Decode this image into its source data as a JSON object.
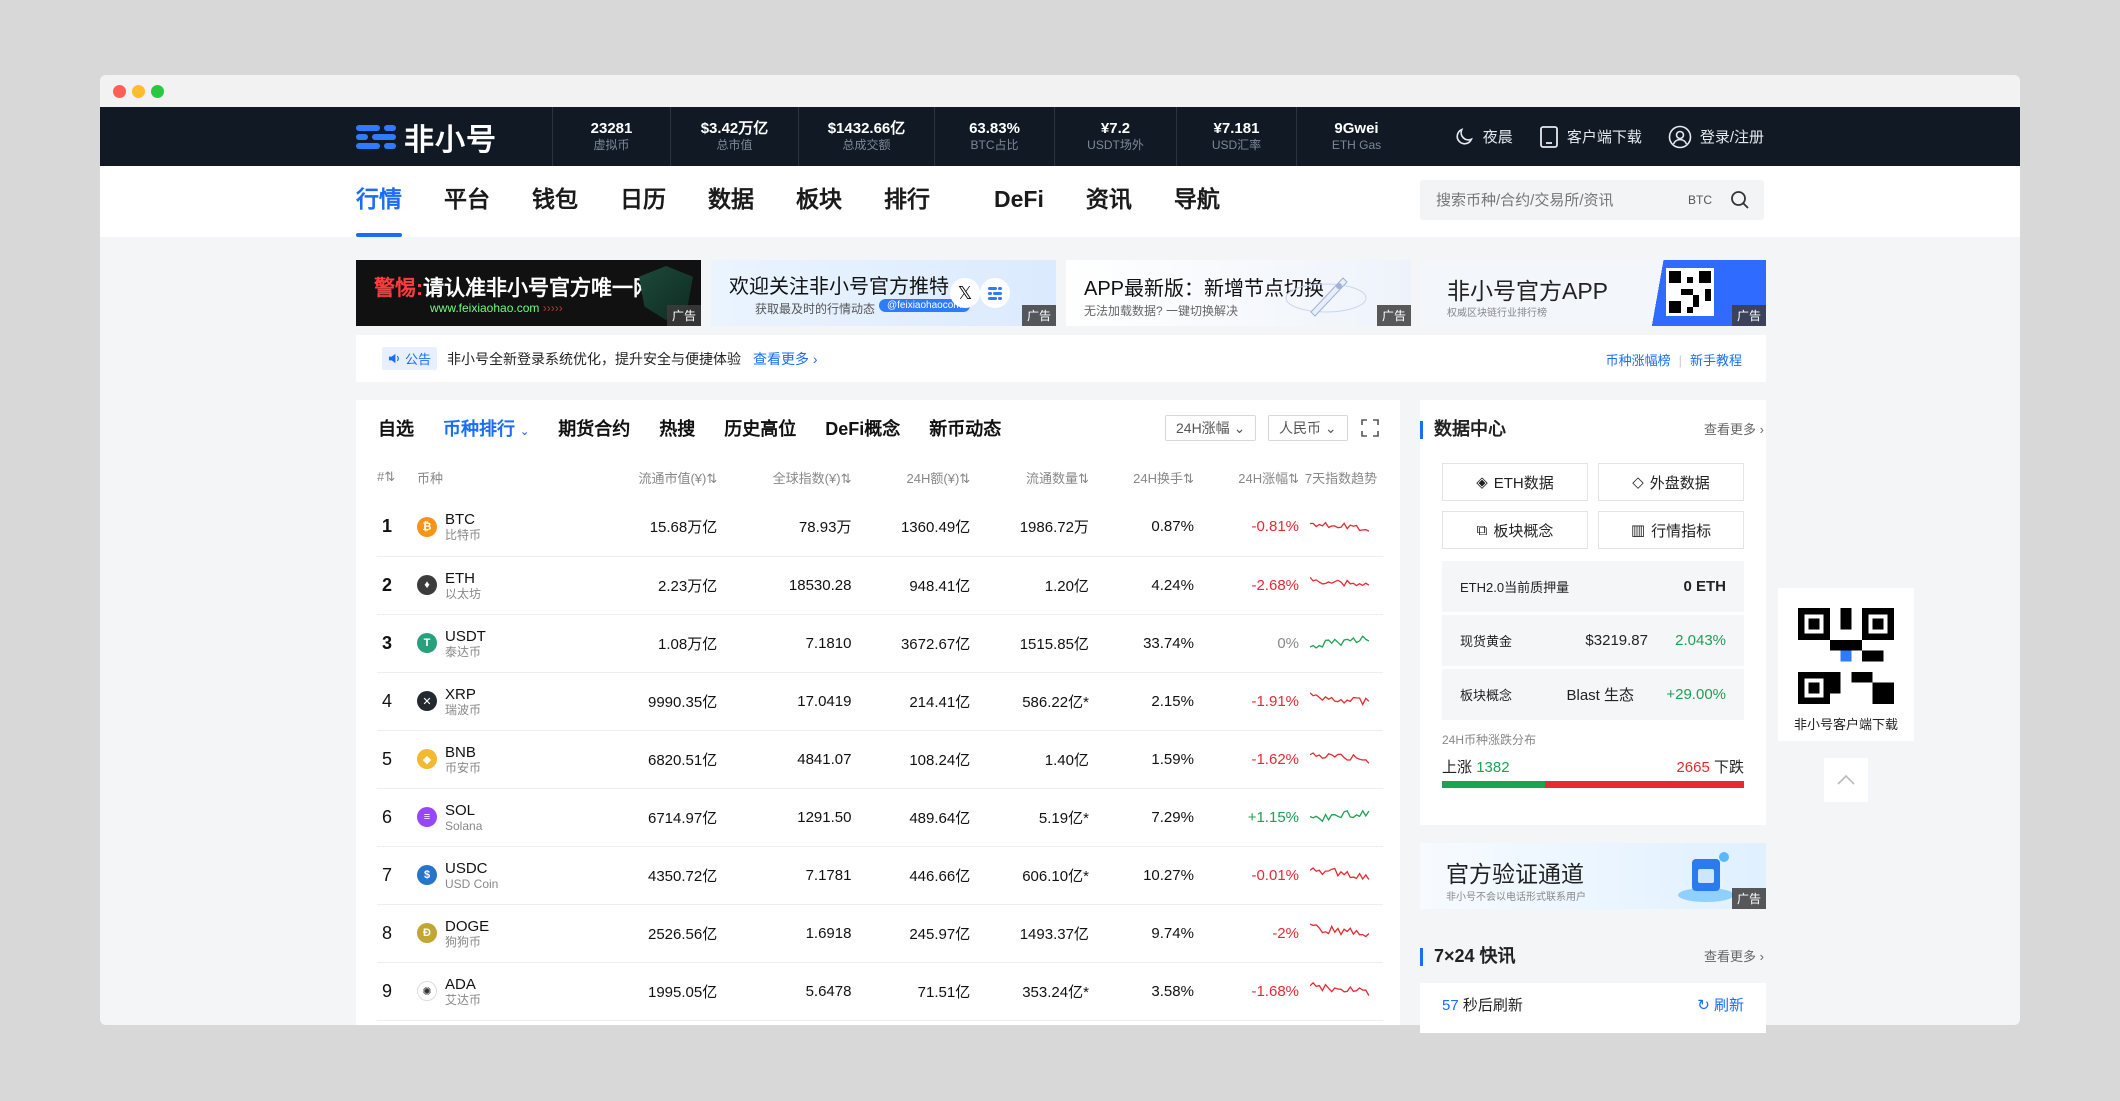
{
  "topbar": {
    "logo_text": "非小号",
    "stats": [
      {
        "value": "23281",
        "label": "虚拟币"
      },
      {
        "value": "$3.42万亿",
        "label": "总市值"
      },
      {
        "value": "$1432.66亿",
        "label": "总成交额"
      },
      {
        "value": "63.83%",
        "label": "BTC占比"
      },
      {
        "value": "¥7.2",
        "label": "USDT场外"
      },
      {
        "value": "¥7.181",
        "label": "USD汇率"
      },
      {
        "value": "9Gwei",
        "label": "ETH Gas"
      }
    ],
    "night_label": "夜晨",
    "download_label": "客户端下载",
    "login_label": "登录/注册"
  },
  "nav": {
    "items": [
      "行情",
      "平台",
      "钱包",
      "日历",
      "数据",
      "板块",
      "排行",
      "DeFi",
      "资讯",
      "导航"
    ],
    "search_placeholder": "搜索币种/合约/交易所/资讯",
    "search_tag": "BTC"
  },
  "banners": {
    "b1_warn": "警惕:",
    "b1_text": "请认准非小号官方唯一网站",
    "b1_url": "www.feixiaohao.com",
    "b1_arrows": "›››››",
    "b2_title": "欢迎关注非小号官方推特",
    "b2_sub": "获取最及时的行情动态",
    "b2_handle": "@feixiaohaocom",
    "b2_x": "𝕏",
    "b3_title": "APP最新版：新增节点切换",
    "b3_sub": "无法加载数据? 一键切换解决",
    "b4_title": "非小号官方APP",
    "b4_sub": "权威区块链行业排行榜",
    "ad_label": "广告"
  },
  "notice": {
    "badge": "公告",
    "text": "非小号全新登录系统优化，提升安全与便捷体验",
    "more": "查看更多",
    "right1": "币种涨幅榜",
    "right2": "新手教程"
  },
  "main": {
    "tabs": [
      "自选",
      "币种排行",
      "期货合约",
      "热搜",
      "历史高位",
      "DeFi概念",
      "新币动态"
    ],
    "select1": "24H涨幅",
    "select2": "人民币",
    "headers": [
      "#",
      "币种",
      "流通市值(¥)",
      "全球指数(¥)",
      "24H额(¥)",
      "流通数量",
      "24H换手",
      "24H涨幅",
      "7天指数趋势"
    ],
    "rows": [
      {
        "rank": "1",
        "sym": "BTC",
        "cn": "比特币",
        "mcap": "15.68万亿",
        "price": "78.93万",
        "vol": "1360.49亿",
        "supply": "1986.72万",
        "turnover": "0.87%",
        "change": "-0.81%",
        "dir": "red",
        "icon_color": "#f7931a",
        "icon_char": "₿"
      },
      {
        "rank": "2",
        "sym": "ETH",
        "cn": "以太坊",
        "mcap": "2.23万亿",
        "price": "18530.28",
        "vol": "948.41亿",
        "supply": "1.20亿",
        "turnover": "4.24%",
        "change": "-2.68%",
        "dir": "red",
        "icon_color": "#3c3c3d",
        "icon_char": "♦"
      },
      {
        "rank": "3",
        "sym": "USDT",
        "cn": "泰达币",
        "mcap": "1.08万亿",
        "price": "7.1810",
        "vol": "3672.67亿",
        "supply": "1515.85亿",
        "turnover": "33.74%",
        "change": "0%",
        "dir": "gray",
        "icon_color": "#26a17b",
        "icon_char": "T"
      },
      {
        "rank": "4",
        "sym": "XRP",
        "cn": "瑞波币",
        "mcap": "9990.35亿",
        "price": "17.0419",
        "vol": "214.41亿",
        "supply": "586.22亿*",
        "turnover": "2.15%",
        "change": "-1.91%",
        "dir": "red",
        "icon_color": "#23292f",
        "icon_char": "✕"
      },
      {
        "rank": "5",
        "sym": "BNB",
        "cn": "币安币",
        "mcap": "6820.51亿",
        "price": "4841.07",
        "vol": "108.24亿",
        "supply": "1.40亿",
        "turnover": "1.59%",
        "change": "-1.62%",
        "dir": "red",
        "icon_color": "#f3ba2f",
        "icon_char": "◆"
      },
      {
        "rank": "6",
        "sym": "SOL",
        "cn": "Solana",
        "mcap": "6714.97亿",
        "price": "1291.50",
        "vol": "489.64亿",
        "supply": "5.19亿*",
        "turnover": "7.29%",
        "change": "+1.15%",
        "dir": "green",
        "icon_color": "#9945ff",
        "icon_char": "≡"
      },
      {
        "rank": "7",
        "sym": "USDC",
        "cn": "USD Coin",
        "mcap": "4350.72亿",
        "price": "7.1781",
        "vol": "446.66亿",
        "supply": "606.10亿*",
        "turnover": "10.27%",
        "change": "-0.01%",
        "dir": "red",
        "icon_color": "#2775ca",
        "icon_char": "$"
      },
      {
        "rank": "8",
        "sym": "DOGE",
        "cn": "狗狗币",
        "mcap": "2526.56亿",
        "price": "1.6918",
        "vol": "245.97亿",
        "supply": "1493.37亿",
        "turnover": "9.74%",
        "change": "-2%",
        "dir": "red",
        "icon_color": "#c2a633",
        "icon_char": "Ð"
      },
      {
        "rank": "9",
        "sym": "ADA",
        "cn": "艾达币",
        "mcap": "1995.05亿",
        "price": "5.6478",
        "vol": "71.51亿",
        "supply": "353.24亿*",
        "turnover": "3.58%",
        "change": "-1.68%",
        "dir": "red",
        "icon_color": "#ffffff",
        "icon_char": "✺"
      }
    ]
  },
  "data_center": {
    "title": "数据中心",
    "more": "查看更多",
    "buttons": [
      "ETH数据",
      "外盘数据",
      "板块概念",
      "行情指标"
    ],
    "eth_stake_label": "ETH2.0当前质押量",
    "eth_stake_value": "0 ETH",
    "gold_label": "现货黄金",
    "gold_price": "$3219.87",
    "gold_change": "2.043%",
    "sector_label": "板块概念",
    "sector_name": "Blast 生态",
    "sector_change": "+29.00%",
    "dist_title": "24H币种涨跌分布",
    "up_label": "上涨",
    "up_count": "1382",
    "down_label": "下跌",
    "down_count": "2665",
    "up_fraction": 0.34
  },
  "verify": {
    "title": "官方验证通道",
    "sub": "非小号不会以电话形式联系用户",
    "ad": "广告"
  },
  "flash": {
    "title": "7×24 快讯",
    "more": "查看更多",
    "count": "57",
    "count_suffix": "秒后刷新",
    "refresh": "刷新"
  },
  "float": {
    "qr_label": "非小号客户端下载"
  }
}
